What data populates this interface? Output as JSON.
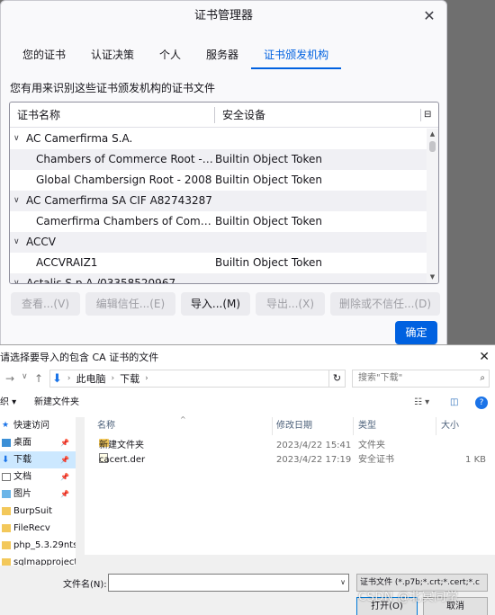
{
  "cert_manager": {
    "title": "证书管理器",
    "tabs": [
      "您的证书",
      "认证决策",
      "个人",
      "服务器",
      "证书颁发机构"
    ],
    "active_tab": "证书颁发机构",
    "description": "您有用来识别这些证书颁发机构的证书文件",
    "columns": {
      "name": "证书名称",
      "device": "安全设备"
    },
    "groups": [
      {
        "name": "AC Camerfirma S.A.",
        "children": [
          {
            "name": "Chambers of Commerce Root - 2…",
            "device": "Builtin Object Token"
          },
          {
            "name": "Global Chambersign Root - 2008",
            "device": "Builtin Object Token"
          }
        ]
      },
      {
        "name": "AC Camerfirma SA CIF A82743287",
        "children": [
          {
            "name": "Camerfirma Chambers of Comme…",
            "device": "Builtin Object Token"
          }
        ]
      },
      {
        "name": "ACCV",
        "children": [
          {
            "name": "ACCVRAIZ1",
            "device": "Builtin Object Token"
          }
        ]
      },
      {
        "name": "Actalis S.p.A./03358520967",
        "children": []
      }
    ],
    "buttons": {
      "view": "查看...(V)",
      "edit_trust": "编辑信任...(E)",
      "import": "导入...(M)",
      "export": "导出...(X)",
      "delete": "删除或不信任...(D)"
    },
    "ok": "确定"
  },
  "file_dialog": {
    "title": "请选择要导入的包含 CA 证书的文件",
    "path": [
      "此电脑",
      "下载"
    ],
    "search_placeholder": "搜索\"下载\"",
    "toolbar": {
      "organize": "织",
      "new_folder": "新建文件夹"
    },
    "nav_items": [
      {
        "label": "快速访问",
        "icon": "star-icon"
      },
      {
        "label": "桌面",
        "icon": "desktop-icon",
        "pinned": true
      },
      {
        "label": "下载",
        "icon": "download-icon",
        "pinned": true,
        "selected": true
      },
      {
        "label": "文档",
        "icon": "document-icon",
        "pinned": true
      },
      {
        "label": "图片",
        "icon": "picture-icon",
        "pinned": true
      },
      {
        "label": "BurpSuit",
        "icon": "folder-icon"
      },
      {
        "label": "FileRecv",
        "icon": "folder-icon"
      },
      {
        "label": "php_5.3.29nts",
        "icon": "folder-icon"
      },
      {
        "label": "sqlmapproject",
        "icon": "folder-icon"
      }
    ],
    "columns": {
      "name": "名称",
      "modified": "修改日期",
      "type": "类型",
      "size": "大小"
    },
    "files": [
      {
        "name": "新建文件夹",
        "modified": "2023/4/22 15:41",
        "type": "文件夹",
        "size": "",
        "icon": "folder-icon"
      },
      {
        "name": "cacert.der",
        "modified": "2023/4/22 17:19",
        "type": "安全证书",
        "size": "1 KB",
        "icon": "certificate-icon"
      }
    ],
    "filename_label": "文件名(N):",
    "filename_value": "",
    "filetype": "证书文件 (*.p7b;*.crt;*.cert;*.c",
    "open": "打开(O)",
    "cancel": "取消"
  },
  "watermark": "CSDN @北冥同学",
  "colors": {
    "accent": "#0061e0",
    "selection": "#cce8ff"
  }
}
